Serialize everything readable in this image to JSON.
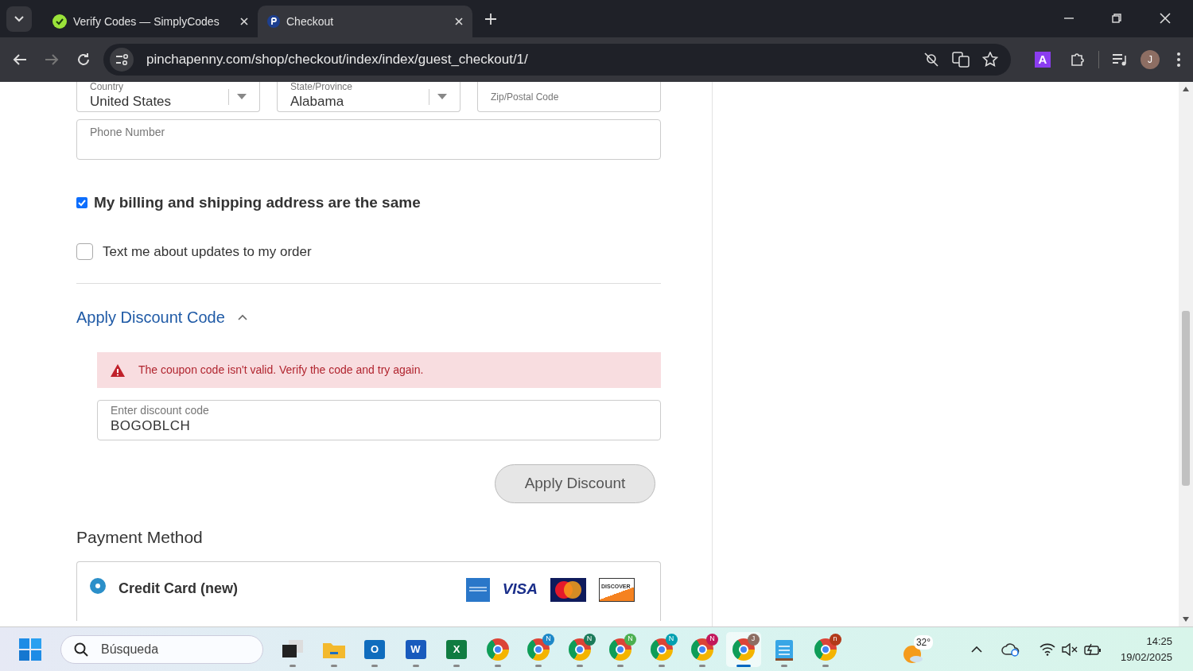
{
  "browser": {
    "tabs": [
      {
        "title": "Verify Codes — SimplyCodes",
        "kind": "simplycodes",
        "selected": false
      },
      {
        "title": "Checkout",
        "kind": "p",
        "selected": true
      }
    ],
    "url": "pinchapenny.com/shop/checkout/index/index/guest_checkout/1/",
    "profile_initial": "J",
    "extension_letter": "A"
  },
  "address_fields": [
    {
      "label": "Country",
      "value": "United States",
      "kind": "select"
    },
    {
      "label": "State/Province",
      "value": "Alabama",
      "kind": "select"
    },
    {
      "label": "Zip/Postal Code",
      "kind": "text"
    }
  ],
  "phone": {
    "placeholder": "Phone Number"
  },
  "options": [
    {
      "label": "My billing and shipping address are the same",
      "checked": true
    },
    {
      "label": "Text me about updates to my order",
      "checked": false
    }
  ],
  "discount": {
    "title": "Apply Discount Code",
    "expanded": true,
    "error": "The coupon code isn't valid. Verify the code and try again.",
    "field_label": "Enter discount code",
    "value": "BOGOBLCH",
    "button": "Apply Discount"
  },
  "payment": {
    "title": "Payment Method",
    "methods": [
      {
        "label": "Credit Card (new)",
        "selected": true
      }
    ],
    "card_logos": [
      {
        "kind": "amex"
      },
      {
        "kind": "visa",
        "text": "VISA"
      },
      {
        "kind": "mastercard"
      },
      {
        "kind": "discover",
        "text": "DISCOVER"
      }
    ]
  },
  "taskbar": {
    "search_placeholder": "Búsqueda",
    "apps": [
      {
        "kind": "taskview",
        "active": false
      },
      {
        "kind": "folder",
        "active": false
      },
      {
        "kind": "outlook",
        "text": "O",
        "active": false
      },
      {
        "kind": "word",
        "text": "W",
        "active": false
      },
      {
        "kind": "excel",
        "text": "X",
        "active": false
      },
      {
        "kind": "chrome",
        "active": false
      },
      {
        "kind": "chrome",
        "badge": "N",
        "color": "#1e88c8",
        "active": false
      },
      {
        "kind": "chrome",
        "badge": "N",
        "color": "#1b7a5a",
        "active": false
      },
      {
        "kind": "chrome",
        "badge": "N",
        "color": "#4caf50",
        "active": false
      },
      {
        "kind": "chrome",
        "badge": "N",
        "color": "#00a0b0",
        "active": false
      },
      {
        "kind": "chrome",
        "badge": "N",
        "color": "#c2185b",
        "active": false
      },
      {
        "kind": "chrome",
        "badge": "J",
        "color": "#8d6e63",
        "active": true
      },
      {
        "kind": "notepad",
        "active": false
      },
      {
        "kind": "chrome",
        "badge": "n",
        "color": "#b23a1a",
        "active": false
      }
    ],
    "weather": "32°",
    "time": "14:25",
    "date": "19/02/2025"
  }
}
